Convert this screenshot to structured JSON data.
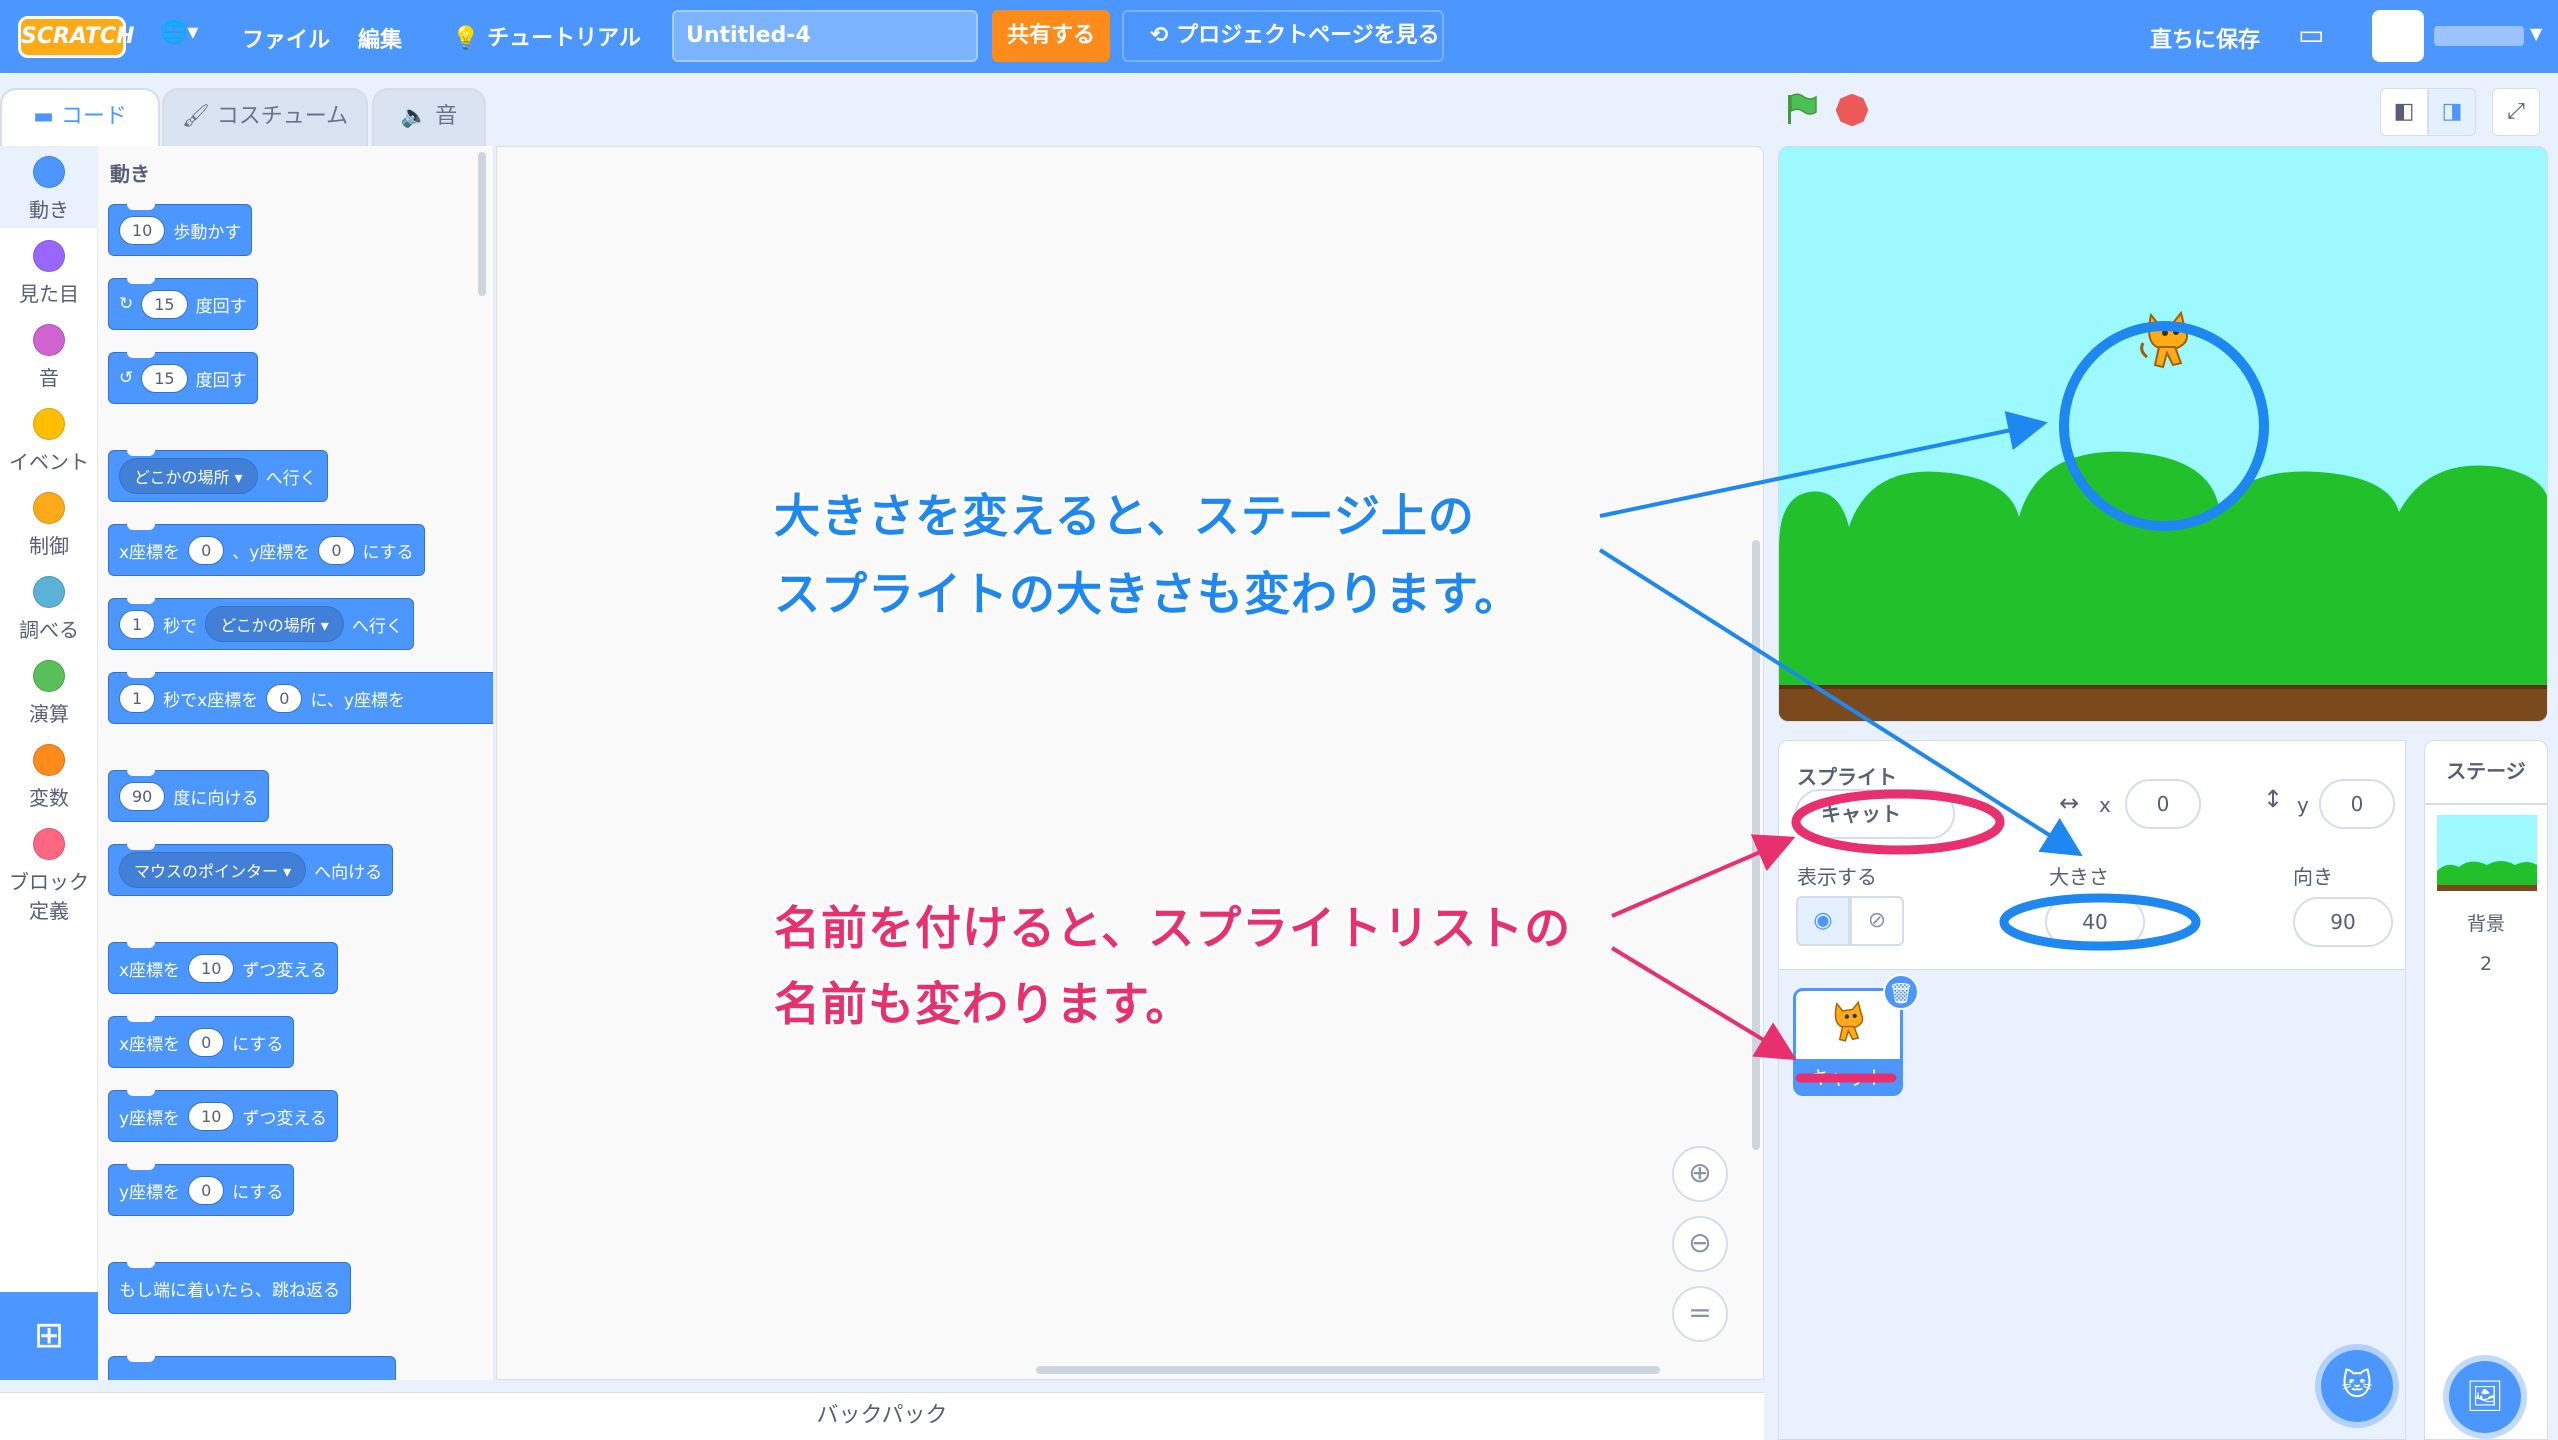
{
  "menubar": {
    "logo": "SCRATCH",
    "file": "ファイル",
    "edit": "編集",
    "tutorial": "チュートリアル",
    "project_title": "Untitled-4",
    "share": "共有する",
    "project_page": "プロジェクトページを見る",
    "save_now": "直ちに保存"
  },
  "tabs": {
    "code": "コード",
    "costume": "コスチューム",
    "sound": "音"
  },
  "categories": [
    {
      "label": "動き",
      "color": "#4c97ff"
    },
    {
      "label": "見た目",
      "color": "#9966ff"
    },
    {
      "label": "音",
      "color": "#cf63cf"
    },
    {
      "label": "イベント",
      "color": "#ffbf00"
    },
    {
      "label": "制御",
      "color": "#ffab19"
    },
    {
      "label": "調べる",
      "color": "#5cb1d6"
    },
    {
      "label": "演算",
      "color": "#59c059"
    },
    {
      "label": "変数",
      "color": "#ff8c1a"
    },
    {
      "label": "ブロック",
      "label2": "定義",
      "color": "#ff6680"
    }
  ],
  "palette": {
    "heading": "動き",
    "b1": {
      "v": "10",
      "t": "歩動かす"
    },
    "b2": {
      "v": "15",
      "t": "度回す"
    },
    "b3": {
      "v": "15",
      "t": "度回す"
    },
    "b4": {
      "d": "どこかの場所",
      "t": "へ行く"
    },
    "b5": {
      "t1": "x座標を",
      "v1": "0",
      "t2": "、y座標を",
      "v2": "0",
      "t3": "にする"
    },
    "b6": {
      "v": "1",
      "t1": "秒で",
      "d": "どこかの場所",
      "t2": "へ行く"
    },
    "b7": {
      "v": "1",
      "t1": "秒でx座標を",
      "v2": "0",
      "t2": "に、y座標を"
    },
    "b8": {
      "v": "90",
      "t": "度に向ける"
    },
    "b9": {
      "d": "マウスのポインター",
      "t": "へ向ける"
    },
    "b10": {
      "t1": "x座標を",
      "v": "10",
      "t2": "ずつ変える"
    },
    "b11": {
      "t1": "x座標を",
      "v": "0",
      "t2": "にする"
    },
    "b12": {
      "t1": "y座標を",
      "v": "10",
      "t2": "ずつ変える"
    },
    "b13": {
      "t1": "y座標を",
      "v": "0",
      "t2": "にする"
    },
    "b14": {
      "t": "もし端に着いたら、跳ね返る"
    }
  },
  "backpack": "バックパック",
  "sprite_info": {
    "sprite_label": "スプライト",
    "sprite_name": "キャット",
    "x_label": "x",
    "x_value": "0",
    "y_label": "y",
    "y_value": "0",
    "show_label": "表示する",
    "size_label": "大きさ",
    "size_value": "40",
    "direction_label": "向き",
    "direction_value": "90"
  },
  "sprite_tile": {
    "name": "キャット"
  },
  "stage_col": {
    "title": "ステージ",
    "backdrop_label": "背景",
    "backdrop_count": "2"
  },
  "annotations": {
    "blue_line1": "大きさを変えると、ステージ上の",
    "blue_line2": "スプライトの大きさも変わります。",
    "pink_line1": "名前を付けると、スプライトリストの",
    "pink_line2": "名前も変わります。"
  },
  "colors": {
    "menubar": "#4c97ff",
    "share": "#ff8c1a",
    "annotation_blue": "#1e88f0",
    "annotation_pink": "#e8306e"
  }
}
